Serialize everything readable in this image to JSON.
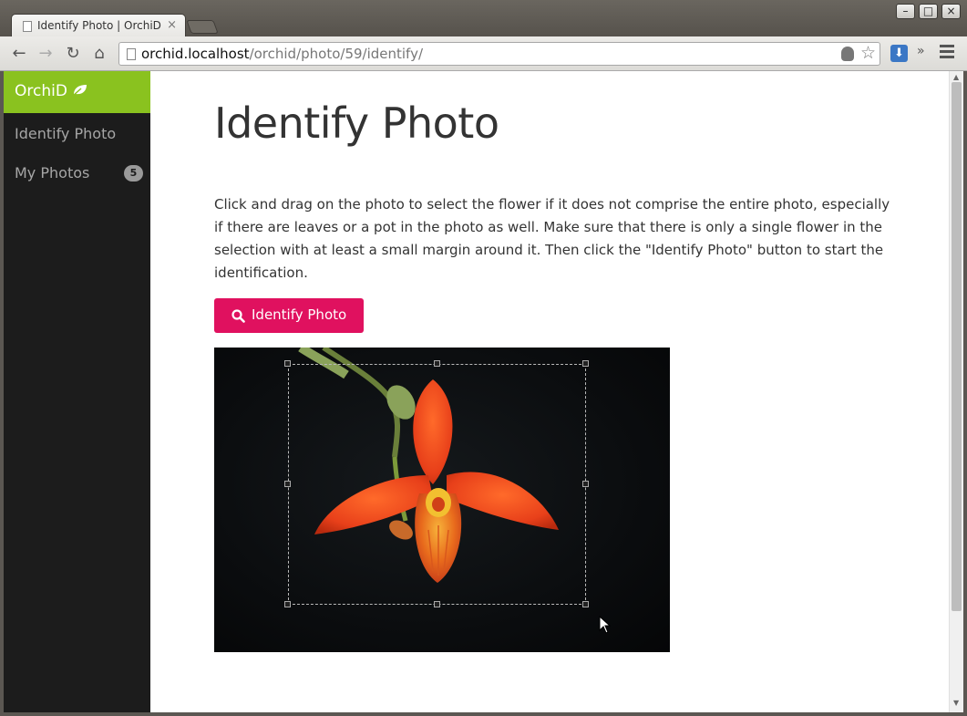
{
  "browser": {
    "tab_title": "Identify Photo | OrchiD",
    "tab_close": "×",
    "url_host": "orchid.localhost",
    "url_path": "/orchid/photo/59/identify/",
    "window_minimize": "–",
    "window_maximize": "□",
    "window_close": "×",
    "overflow": "»"
  },
  "sidebar": {
    "brand": "OrchiD",
    "items": [
      {
        "label": "Identify Photo"
      },
      {
        "label": "My Photos",
        "badge": "5"
      }
    ]
  },
  "main": {
    "title": "Identify Photo",
    "instructions": "Click and drag on the photo to select the flower if it does not comprise the entire photo, especially if there are leaves or a pot in the photo as well. Make sure that there is only a single flower in the selection with at least a small margin around it. Then click the \"Identify Photo\" button to start the identification.",
    "identify_button": "Identify Photo"
  },
  "colors": {
    "brand_green": "#8ac21f",
    "button_pink": "#e0115f",
    "sidebar_bg": "#1c1c1c"
  }
}
